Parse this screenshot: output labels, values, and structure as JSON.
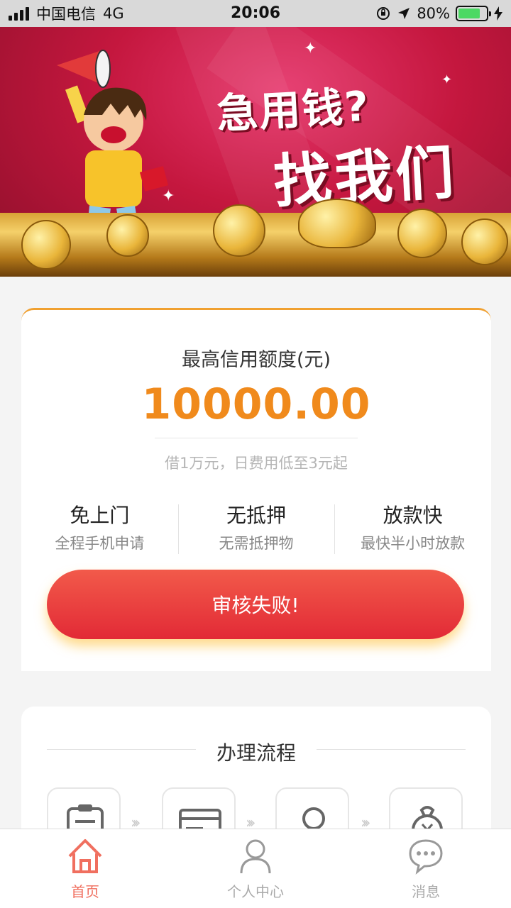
{
  "status_bar": {
    "carrier": "中国电信",
    "network": "4G",
    "time": "20:06",
    "battery": "80%",
    "battery_level": 0.8
  },
  "banner": {
    "line1": "急用钱?",
    "line2": "找我们"
  },
  "credit_card": {
    "label": "最高信用额度(元)",
    "amount": "10000.00",
    "promo": "借1万元，日费用低至3元起",
    "features": [
      {
        "title": "免上门",
        "subtitle": "全程手机申请"
      },
      {
        "title": "无抵押",
        "subtitle": "无需抵押物"
      },
      {
        "title": "放款快",
        "subtitle": "最快半小时放款"
      }
    ],
    "status_button": "审核失败!"
  },
  "process": {
    "title": "办理流程",
    "steps": [
      "clipboard-icon",
      "card-icon",
      "lightbulb-icon",
      "money-bag-icon"
    ]
  },
  "tabbar": {
    "tabs": [
      {
        "label": "首页",
        "icon": "home-icon",
        "active": true
      },
      {
        "label": "个人中心",
        "icon": "user-icon",
        "active": false
      },
      {
        "label": "消息",
        "icon": "chat-icon",
        "active": false
      }
    ]
  },
  "colors": {
    "accent_orange": "#f08a1c",
    "button_red": "#e22a36",
    "tab_active": "#f06f5f"
  }
}
